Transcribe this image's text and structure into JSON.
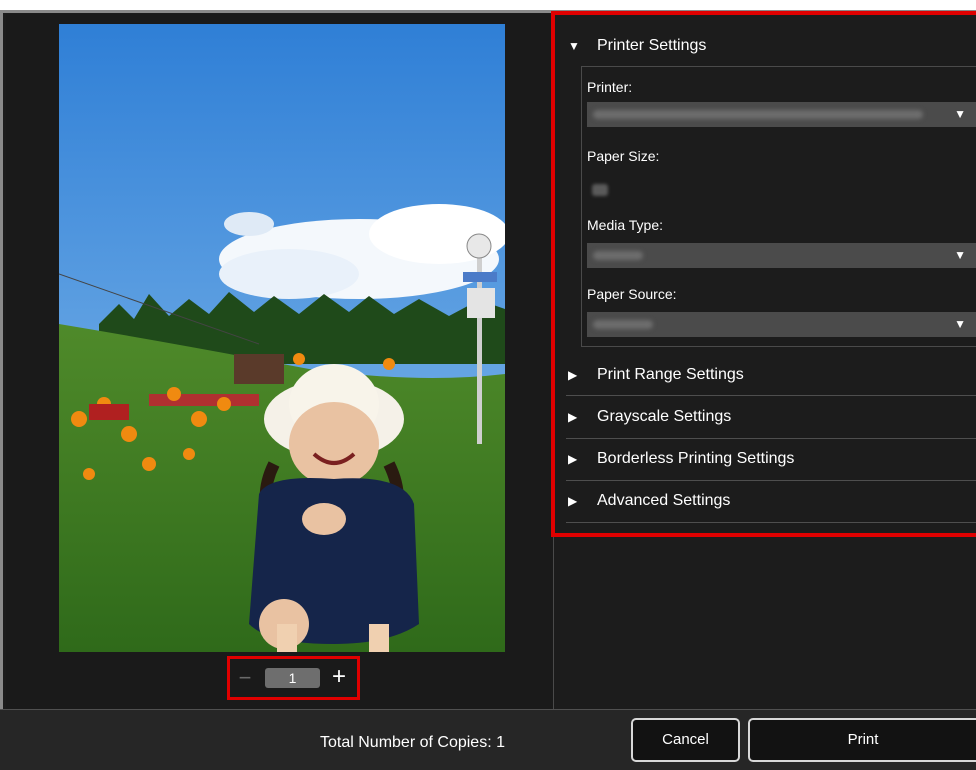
{
  "preview": {
    "copies_value": "1",
    "minus_glyph": "−",
    "plus_glyph": "+"
  },
  "settings": {
    "printer_settings_title": "Printer Settings",
    "printer_label": "Printer:",
    "paper_size_label": "Paper Size:",
    "media_type_label": "Media Type:",
    "paper_source_label": "Paper Source:",
    "collapsed_sections": [
      {
        "label": "Print Range Settings"
      },
      {
        "label": "Grayscale Settings"
      },
      {
        "label": "Borderless Printing Settings"
      },
      {
        "label": "Advanced Settings"
      }
    ],
    "expanded_arrow": "▼",
    "collapsed_arrow": "▶",
    "select_caret": "▼"
  },
  "footer": {
    "total_copies_text": "Total Number of Copies: 1",
    "cancel_label": "Cancel",
    "print_label": "Print"
  },
  "colors": {
    "highlight": "#e00000",
    "background": "#1c1c1c"
  }
}
